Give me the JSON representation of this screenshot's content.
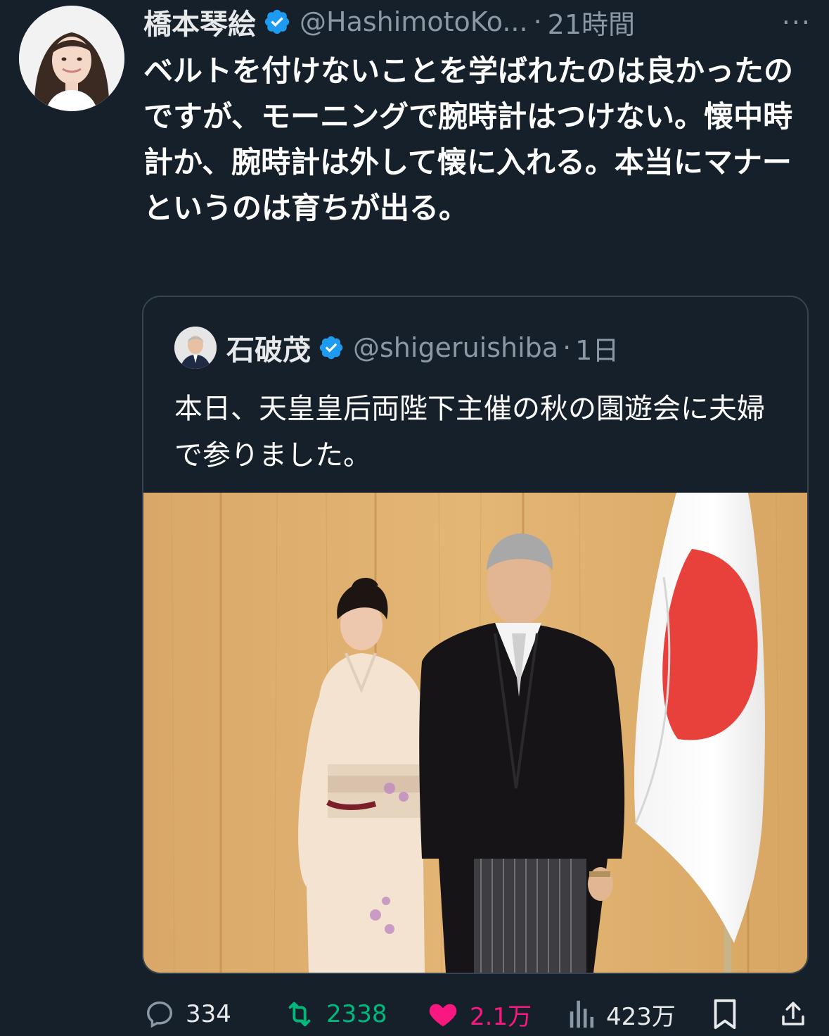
{
  "colors": {
    "background": "#15202b",
    "verified": "#1d9bf0",
    "retweet_active": "#00ba7c",
    "like_active": "#f91880",
    "secondary_text": "#8b98a5"
  },
  "tweet": {
    "author_name": "橋本琴絵",
    "author_handle": "@HashimotoKo...",
    "separator": "·",
    "timestamp": "21時間",
    "more_label": "···",
    "text": "ベルトを付けないことを学ばれたのは良かったのですが、モーニングで腕時計はつけない。懐中時計か、腕時計は外して懐に入れる。本当にマナーというのは育ちが出る。"
  },
  "quoted": {
    "author_name": "石破茂",
    "author_handle": "@shigeruishiba",
    "separator": "·",
    "timestamp": "1日",
    "text": "本日、天皇皇后両陛下主催の秋の園遊会に夫婦で参りました。"
  },
  "actions": {
    "replies": "334",
    "retweets": "2338",
    "likes": "2.1万",
    "views": "423万"
  },
  "icons": {
    "reply": "reply-icon",
    "retweet": "retweet-icon",
    "like": "heart-icon",
    "views": "views-chart-icon",
    "bookmark": "bookmark-icon",
    "share": "share-icon",
    "verified": "verified-badge-icon",
    "more": "more-icon"
  }
}
